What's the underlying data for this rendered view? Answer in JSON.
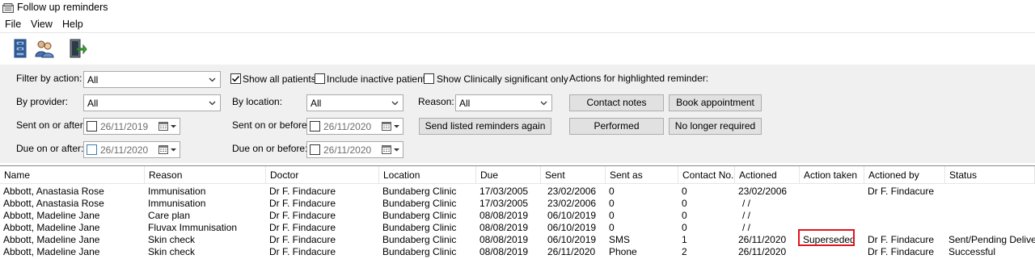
{
  "window": {
    "title": "Follow up reminders"
  },
  "menu": [
    "File",
    "View",
    "Help"
  ],
  "toolbar": {
    "icons": [
      "filing-cabinet-icon",
      "patients-icon",
      "exit-door-icon"
    ]
  },
  "filters": {
    "filter_by_action": {
      "label": "Filter by action:",
      "value": "All"
    },
    "show_all_patients": {
      "label": "Show all patients",
      "checked": true
    },
    "include_inactive": {
      "label": "Include inactive patients",
      "checked": false
    },
    "clinically_significant": {
      "label": "Show Clinically significant only",
      "checked": false
    },
    "actions_label": "Actions for highlighted reminder:",
    "by_provider": {
      "label": "By provider:",
      "value": "All"
    },
    "by_location": {
      "label": "By location:",
      "value": "All"
    },
    "reason": {
      "label": "Reason:",
      "value": "All"
    },
    "sent_on_after": {
      "label": "Sent on or after:",
      "value": "26/11/2019"
    },
    "sent_on_before": {
      "label": "Sent on or before:",
      "value": "26/11/2020"
    },
    "due_on_after": {
      "label": "Due on or after:",
      "value": "26/11/2020"
    },
    "due_on_before": {
      "label": "Due on or before:",
      "value": "26/11/2020"
    }
  },
  "buttons": {
    "contact_notes": "Contact notes",
    "book_appointment": "Book appointment",
    "send_again": "Send listed reminders again",
    "performed": "Performed",
    "no_longer_required": "No longer required"
  },
  "table": {
    "columns": [
      "Name",
      "Reason",
      "Doctor",
      "Location",
      "Due",
      "Sent",
      "Sent as",
      "Contact No.",
      "Actioned",
      "Action taken",
      "Actioned by",
      "Status"
    ],
    "rows": [
      [
        "Abbott, Anastasia Rose",
        "Immunisation",
        "Dr F. Findacure",
        "Bundaberg Clinic",
        "17/03/2005",
        "23/02/2006",
        "0",
        "0",
        "23/02/2006",
        "",
        "Dr F. Findacure",
        ""
      ],
      [
        "Abbott, Anastasia Rose",
        "Immunisation",
        "Dr F. Findacure",
        "Bundaberg Clinic",
        "17/03/2005",
        "23/02/2006",
        "0",
        "0",
        "/ /",
        "",
        "",
        ""
      ],
      [
        "Abbott, Madeline Jane",
        "Care plan",
        "Dr F. Findacure",
        "Bundaberg Clinic",
        "08/08/2019",
        "06/10/2019",
        "0",
        "0",
        "/ /",
        "",
        "",
        ""
      ],
      [
        "Abbott, Madeline Jane",
        "Fluvax Immunisation",
        "Dr F. Findacure",
        "Bundaberg Clinic",
        "08/08/2019",
        "06/10/2019",
        "0",
        "0",
        "/ /",
        "",
        "",
        ""
      ],
      [
        "Abbott, Madeline Jane",
        "Skin check",
        "Dr F. Findacure",
        "Bundaberg Clinic",
        "08/08/2019",
        "06/10/2019",
        "SMS",
        "1",
        "26/11/2020",
        "Superseded",
        "Dr F. Findacure",
        "Sent/Pending Delive"
      ],
      [
        "Abbott, Madeline Jane",
        "Skin check",
        "Dr F. Findacure",
        "Bundaberg Clinic",
        "08/08/2019",
        "26/11/2020",
        "Phone",
        "2",
        "26/11/2020",
        "",
        "Dr F. Findacure",
        "Successful"
      ]
    ]
  },
  "colors": {
    "highlight": "#e0141e",
    "panel": "#f0f0f0",
    "button": "#e1e1e1"
  }
}
